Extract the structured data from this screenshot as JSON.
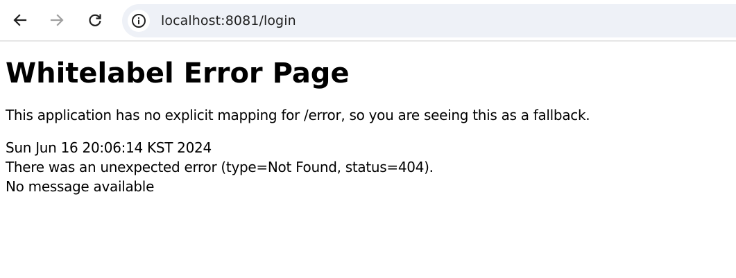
{
  "browser": {
    "url": "localhost:8081/login",
    "icons": {
      "back": "arrow-left-icon",
      "forward": "arrow-right-icon",
      "reload": "reload-icon",
      "site_info": "info-icon"
    }
  },
  "page": {
    "title": "Whitelabel Error Page",
    "description": "This application has no explicit mapping for /error, so you are seeing this as a fallback.",
    "timestamp": "Sun Jun 16 20:06:14 KST 2024",
    "error_line": "There was an unexpected error (type=Not Found, status=404).",
    "message": "No message available"
  }
}
